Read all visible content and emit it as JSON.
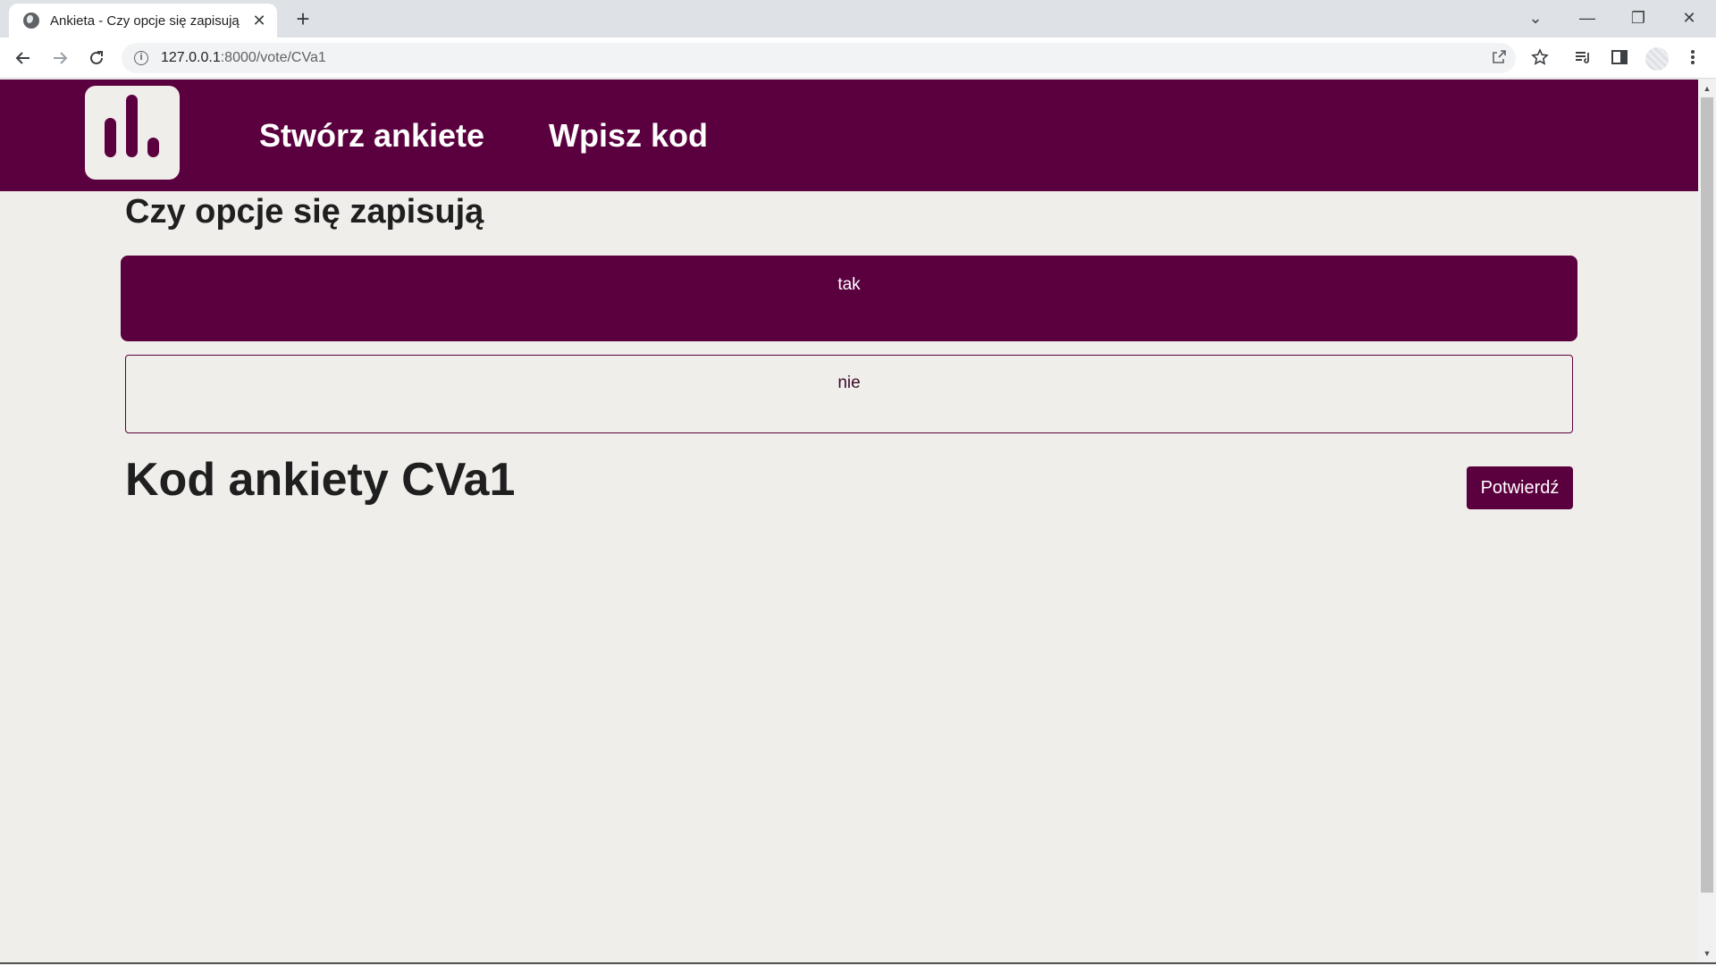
{
  "browser": {
    "tab_title": "Ankieta - Czy opcje się zapisują",
    "tab_close": "✕",
    "new_tab": "+",
    "url_host": "127.0.0.1",
    "url_path": ":8000/vote/CVa1",
    "window_controls": [
      "⌄",
      "—",
      "❐",
      "✕"
    ]
  },
  "header": {
    "nav": [
      "Stwórz ankiete",
      "Wpisz kod"
    ]
  },
  "poll": {
    "question": "Czy opcje się zapisują",
    "options": [
      {
        "label": "tak",
        "selected": true
      },
      {
        "label": "nie",
        "selected": false
      }
    ],
    "code_heading": "Kod ankiety CVa1",
    "confirm_label": "Potwierdź"
  },
  "colors": {
    "brand": "#5b003e",
    "background": "#f0eeeb"
  }
}
